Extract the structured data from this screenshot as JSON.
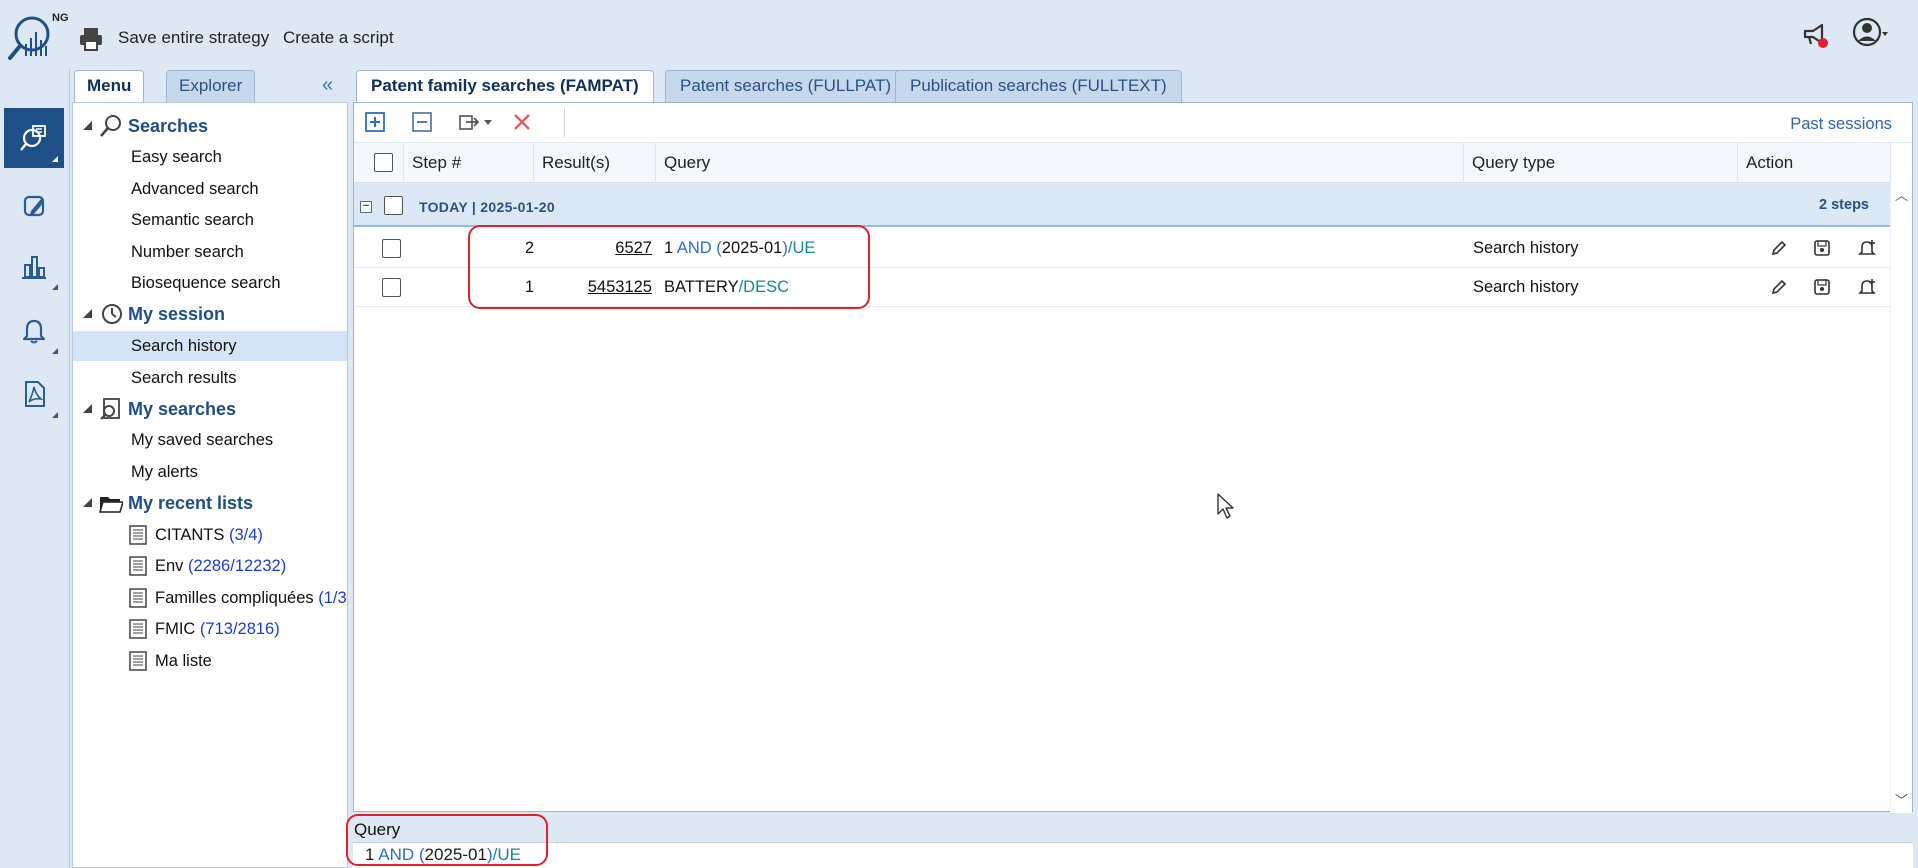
{
  "toolbar": {
    "save_label": "Save entire strategy",
    "script_label": "Create a script",
    "logo_badge": "NG"
  },
  "icons": {
    "print": "printer-icon",
    "announce": "megaphone-icon",
    "user": "user-account-icon",
    "rail": [
      "search-screen-icon",
      "edit-note-icon",
      "bar-chart-icon",
      "bell-icon",
      "pdf-document-icon"
    ]
  },
  "left_tabs": {
    "menu": "Menu",
    "explorer": "Explorer",
    "collapse": "«"
  },
  "tree": {
    "searches": {
      "title": "Searches",
      "items": [
        "Easy search",
        "Advanced search",
        "Semantic search",
        "Number search",
        "Biosequence search"
      ]
    },
    "session": {
      "title": "My session",
      "items": [
        "Search history",
        "Search results"
      ],
      "selected": "Search history"
    },
    "my_searches": {
      "title": "My searches",
      "items": [
        "My saved searches",
        "My alerts"
      ]
    },
    "recent_lists": {
      "title": "My recent lists",
      "items": [
        {
          "name": "CITANTS",
          "count": "(3/4)"
        },
        {
          "name": "Env",
          "count": "(2286/12232)"
        },
        {
          "name": "Familles compliquées",
          "count": "(1/3"
        },
        {
          "name": "FMIC",
          "count": "(713/2816)"
        },
        {
          "name": "Ma liste",
          "count": ""
        }
      ]
    }
  },
  "main_tabs": [
    "Patent family searches (FAMPAT)",
    "Patent searches (FULLPAT)",
    "Publication searches (FULLTEXT)"
  ],
  "main": {
    "past_sessions": "Past sessions",
    "columns": [
      "Step #",
      "Result(s)",
      "Query",
      "Query type",
      "Action"
    ],
    "group": {
      "label": "TODAY | 2025-01-20",
      "steps": "2 steps"
    },
    "rows": [
      {
        "step": "2",
        "results": "6527",
        "query": {
          "p1": "1 ",
          "kw": "AND",
          "p2": " (",
          "p3": "2025-01",
          "p4": ")",
          "fld": "/UE"
        },
        "type": "Search history"
      },
      {
        "step": "1",
        "results": "5453125",
        "query": {
          "p1": "BATTERY",
          "fld": "/DESC"
        },
        "type": "Search history"
      }
    ]
  },
  "query_preview": {
    "label": "Query",
    "p1": "1 ",
    "kw": "AND",
    "p2": " (",
    "p3": "2025-01",
    "p4": ")",
    "fld": "/UE"
  },
  "colors": {
    "accent": "#1f4f87",
    "highlight": "#e0202a",
    "keyword": "#2a6fcc",
    "field": "#168a8a"
  }
}
